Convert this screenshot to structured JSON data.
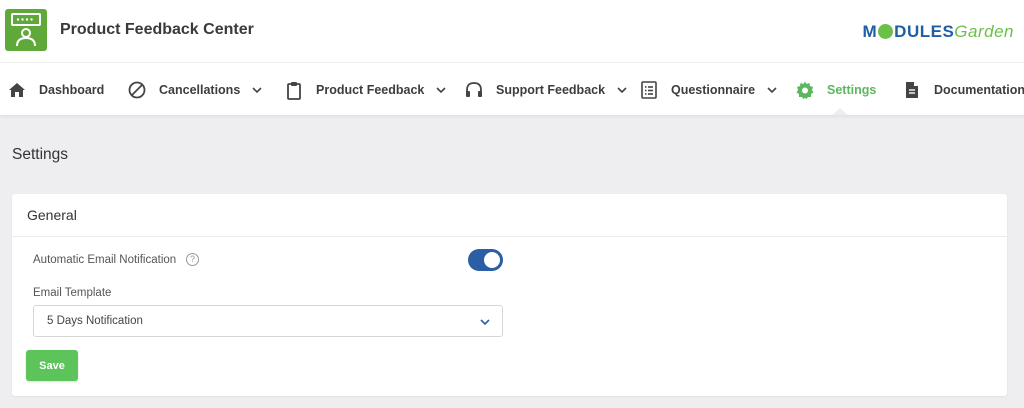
{
  "header": {
    "app_title": "Product Feedback Center",
    "brand_part1": "M",
    "brand_part2": "DULES",
    "brand_part3": "Garden"
  },
  "nav": {
    "items": [
      {
        "label": "Dashboard",
        "icon": "home-icon"
      },
      {
        "label": "Cancellations",
        "icon": "ban-icon"
      },
      {
        "label": "Product Feedback",
        "icon": "clipboard-icon"
      },
      {
        "label": "Support Feedback",
        "icon": "headset-icon"
      },
      {
        "label": "Questionnaire",
        "icon": "list-icon"
      },
      {
        "label": "Settings",
        "icon": "gear-icon"
      },
      {
        "label": "Documentation",
        "icon": "document-icon"
      }
    ],
    "active": "Settings"
  },
  "page": {
    "title": "Settings"
  },
  "general": {
    "title": "General",
    "auto_email_label": "Automatic Email Notification",
    "auto_email_enabled": true,
    "email_template_label": "Email Template",
    "email_template_value": "5 Days Notification",
    "save_label": "Save"
  },
  "colors": {
    "accent_green": "#5cc45a",
    "toggle_blue": "#2b5fa5",
    "logo_green": "#5fa83a"
  }
}
